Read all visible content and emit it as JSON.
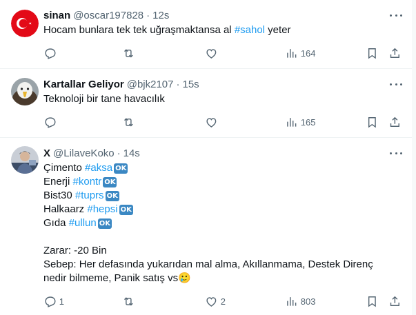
{
  "tweets": [
    {
      "name": "sinan",
      "handle": "@oscar197828",
      "time": "12s",
      "text_parts": [
        "Hocam bunlara tek tek uğraşmaktansa al ",
        "#sahol",
        " yeter"
      ],
      "replies": "",
      "retweets": "",
      "likes": "",
      "views": "164",
      "avatar": "turkey-flag"
    },
    {
      "name": "Kartallar Geliyor",
      "handle": "@bjk2107",
      "time": "15s",
      "text": "Teknoloji bir tane havacılık",
      "replies": "",
      "retweets": "",
      "likes": "",
      "views": "165",
      "avatar": "eagle"
    },
    {
      "name": "X",
      "handle": "@LilaveKoko",
      "time": "14s",
      "lines": [
        {
          "label": "Çimento ",
          "tag": "#aksa",
          "badge": "OK"
        },
        {
          "label": "Enerji ",
          "tag": "#kontr",
          "badge": "OK"
        },
        {
          "label": "Bist30 ",
          "tag": "#tuprs",
          "badge": "OK"
        },
        {
          "label": "Halkaarz ",
          "tag": "#hepsi",
          "badge": "OK"
        },
        {
          "label": "Gıda ",
          "tag": "#ullun",
          "badge": "OK"
        }
      ],
      "summary_1": "Zarar: -20 Bin",
      "summary_2": "Sebep: Her defasında yukarıdan mal alma, Akıllanmama, Destek Direnç",
      "summary_3": "nedir bilmeme, Panik satış vs",
      "emoji": "🥲",
      "replies": "1",
      "retweets": "",
      "likes": "2",
      "views": "803",
      "avatar": "person-photo"
    }
  ],
  "separator": "·",
  "colors": {
    "accent": "#1d9bf0",
    "secondary_text": "#536471",
    "ok_badge": "#3b88c3"
  }
}
